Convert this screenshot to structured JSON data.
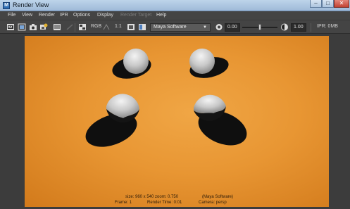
{
  "window": {
    "title": "Render View",
    "app_icon_letter": "M",
    "controls": {
      "minimize": "–",
      "maximize": "□",
      "close": "✕"
    }
  },
  "menubar": {
    "items": [
      {
        "label": "File",
        "enabled": true
      },
      {
        "label": "View",
        "enabled": true
      },
      {
        "label": "Render",
        "enabled": true
      },
      {
        "label": "IPR",
        "enabled": true
      },
      {
        "label": "Options",
        "enabled": true
      },
      {
        "label": "Display",
        "enabled": true
      },
      {
        "label": "Render Target",
        "enabled": false
      },
      {
        "label": "Help",
        "enabled": true
      }
    ]
  },
  "toolbar": {
    "rgb_label": "RGB",
    "zoom_label": "1:1",
    "renderer": "Maya Software",
    "exposure_value": "0.00",
    "gamma_value": "1.00",
    "ipr_memory": "IPR: 0MB"
  },
  "render": {
    "background_colors": [
      "#f0a645",
      "#e89633",
      "#d27a1b"
    ],
    "hud": {
      "size_line": "size: 960 x 540  zoom: 0.750",
      "renderer_line": "(Maya Software)",
      "frame_line": "Frame: 1",
      "time_line": "Render Time: 0:01",
      "camera_line": "Camera: persp"
    }
  }
}
